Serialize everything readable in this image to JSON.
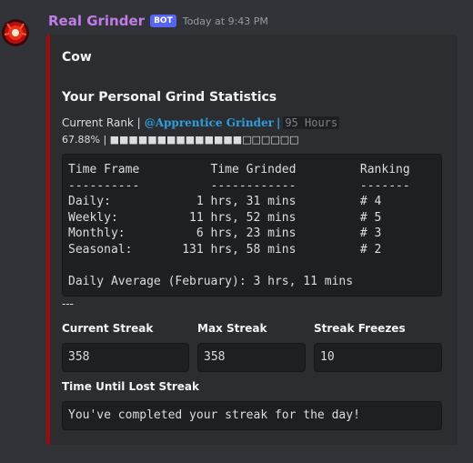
{
  "message": {
    "username": "Real Grinder",
    "bot_tag": "BOT",
    "timestamp": "Today at 9:43 PM"
  },
  "embed": {
    "author": "Cow",
    "title": "Your Personal Grind Statistics",
    "rank_prefix": "Current Rank |",
    "rank_name": "@Apprentice Grinder",
    "rank_separator": "|",
    "rank_hours": "95 Hours",
    "progress_text": "67.88% | ■■■■■■■■■■■■■■□□□□□□",
    "stats_block": "Time Frame          Time Grinded         Ranking\n----------          ------------         -------\nDaily:            1 hrs, 31 mins         # 4\nWeekly:          11 hrs, 52 mins         # 5\nMonthly:          6 hrs, 23 mins         # 3\nSeasonal:       131 hrs, 58 mins         # 2\n\nDaily Average (February): 3 hrs, 11 mins",
    "divider": "---",
    "fields": [
      {
        "name": "Current Streak",
        "value": "358"
      },
      {
        "name": "Max Streak",
        "value": "358"
      },
      {
        "name": "Streak Freezes",
        "value": "10"
      },
      {
        "name": "Time Until Lost Streak",
        "value": "You've completed your streak for the day!"
      }
    ],
    "accent_color": "#9d0b0b"
  }
}
